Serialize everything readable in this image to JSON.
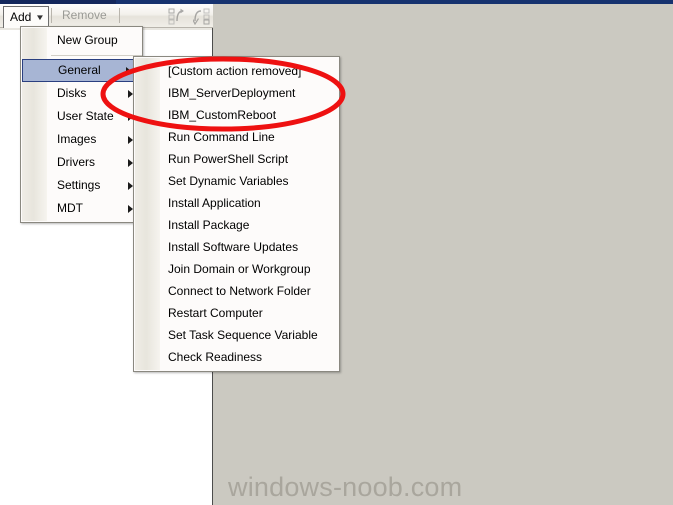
{
  "window": {
    "titlebar_color": "#16326f",
    "background_color": "#cbc9c1"
  },
  "toolbar": {
    "add_label": "Add",
    "add_caret": "▼",
    "remove_label": "Remove",
    "icons": [
      {
        "name": "move-up-icon",
        "glyph": "↻"
      },
      {
        "name": "move-down-icon",
        "glyph": "↳"
      }
    ]
  },
  "add_menu": {
    "items": [
      {
        "label": "New Group",
        "has_submenu": false,
        "selected": false
      },
      {
        "label": "General",
        "has_submenu": true,
        "selected": true
      },
      {
        "label": "Disks",
        "has_submenu": true,
        "selected": false
      },
      {
        "label": "User State",
        "has_submenu": true,
        "selected": false
      },
      {
        "label": "Images",
        "has_submenu": true,
        "selected": false
      },
      {
        "label": "Drivers",
        "has_submenu": true,
        "selected": false
      },
      {
        "label": "Settings",
        "has_submenu": true,
        "selected": false
      },
      {
        "label": "MDT",
        "has_submenu": true,
        "selected": false
      }
    ]
  },
  "general_submenu": {
    "items": [
      {
        "label": "[Custom action removed]"
      },
      {
        "label": "IBM_ServerDeployment"
      },
      {
        "label": "IBM_CustomReboot"
      },
      {
        "label": "Run Command Line"
      },
      {
        "label": "Run PowerShell Script"
      },
      {
        "label": "Set Dynamic Variables"
      },
      {
        "label": "Install Application"
      },
      {
        "label": "Install Package"
      },
      {
        "label": "Install Software Updates"
      },
      {
        "label": "Join Domain or Workgroup"
      },
      {
        "label": "Connect to Network Folder"
      },
      {
        "label": "Restart Computer"
      },
      {
        "label": "Set Task Sequence Variable"
      },
      {
        "label": "Check Readiness"
      }
    ]
  },
  "annotation": {
    "shape": "ellipse",
    "color": "#ee1111",
    "stroke_width": 5
  },
  "watermark": {
    "text": "windows-noob.com",
    "color": "#a9a69d"
  }
}
